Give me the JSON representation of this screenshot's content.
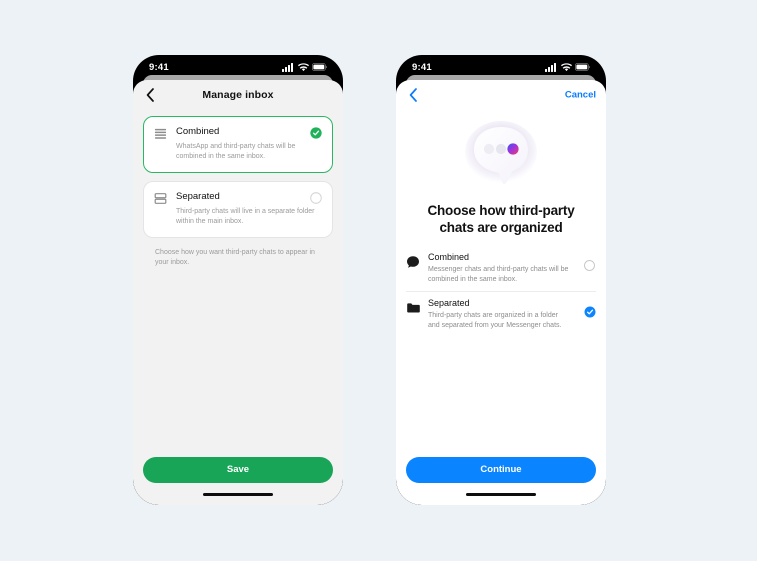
{
  "canvas": {
    "background": "#edf2f6"
  },
  "phone_left": {
    "status_bar": {
      "time": "9:41",
      "icons": [
        "signal-icon",
        "wifi-icon",
        "battery-icon"
      ]
    },
    "nav": {
      "back_icon": "chevron-left-icon",
      "title": "Manage inbox"
    },
    "options": [
      {
        "icon": "list-lines-icon",
        "title": "Combined",
        "description": "WhatsApp and third-party chats will be combined in the same inbox.",
        "selected": true,
        "marker": "check-circle-filled-icon"
      },
      {
        "icon": "stacked-rows-icon",
        "title": "Separated",
        "description": "Third-party chats will live in a separate folder within the main inbox.",
        "selected": false,
        "marker": "radio-empty-icon"
      }
    ],
    "hint": "Choose how you want third-party chats to appear in your inbox.",
    "primary_button": {
      "label": "Save",
      "color": "#18a558"
    },
    "home_indicator": "home-indicator"
  },
  "phone_right": {
    "status_bar": {
      "time": "9:41",
      "icons": [
        "signal-icon",
        "wifi-icon",
        "battery-icon"
      ]
    },
    "nav": {
      "back_icon": "chevron-left-icon",
      "cancel_label": "Cancel",
      "accent": "#0a7cff"
    },
    "hero": {
      "illustration": "speech-bubble-three-dots-illustration"
    },
    "headline": "Choose how third-party chats are organized",
    "options": [
      {
        "icon": "chat-bubble-filled-icon",
        "title": "Combined",
        "description": "Messenger chats and third-party chats will be combined in the same inbox.",
        "selected": false,
        "marker": "radio-empty-icon"
      },
      {
        "icon": "folder-filled-icon",
        "title": "Separated",
        "description": "Third-party chats are organized in a folder and separated from your Messenger chats.",
        "selected": true,
        "marker": "check-circle-filled-blue-icon"
      }
    ],
    "primary_button": {
      "label": "Continue",
      "color": "#0a84ff"
    },
    "home_indicator": "home-indicator"
  }
}
